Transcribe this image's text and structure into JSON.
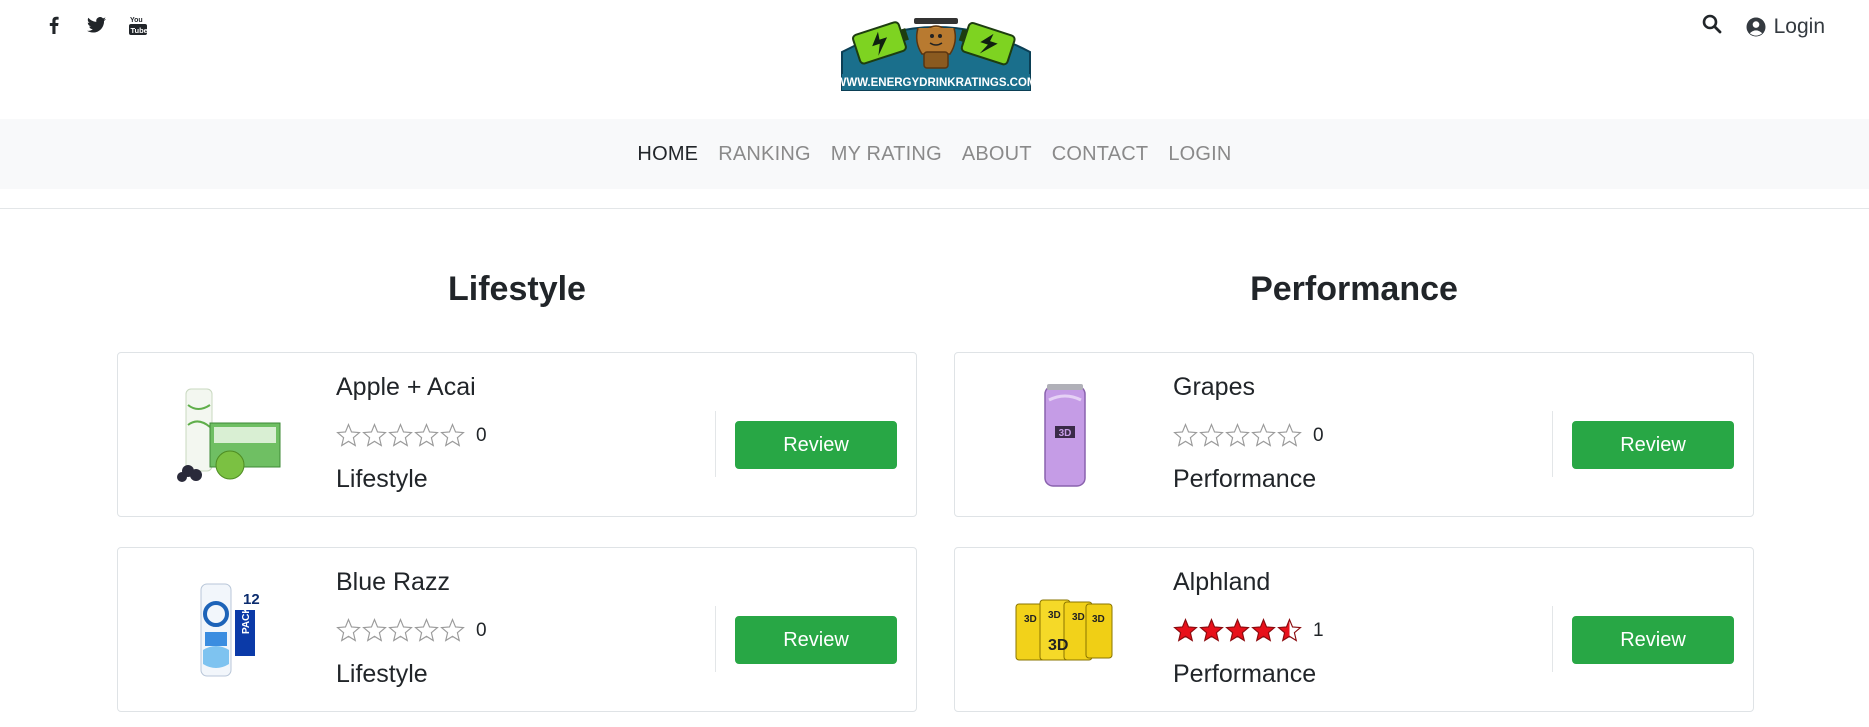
{
  "header": {
    "social": [
      "facebook-icon",
      "twitter-icon",
      "youtube-icon"
    ],
    "logo_text": "WWW.ENERGYDRINKRATINGS.COM",
    "login_label": "Login"
  },
  "nav": {
    "items": [
      {
        "label": "HOME",
        "active": true
      },
      {
        "label": "RANKING",
        "active": false
      },
      {
        "label": "MY RATING",
        "active": false
      },
      {
        "label": "ABOUT",
        "active": false
      },
      {
        "label": "CONTACT",
        "active": false
      },
      {
        "label": "LOGIN",
        "active": false
      }
    ]
  },
  "columns": [
    {
      "title": "Lifestyle",
      "cards": [
        {
          "name": "Apple + Acai",
          "rating": 0,
          "count": "0",
          "category": "Lifestyle",
          "button": "Review"
        },
        {
          "name": "Blue Razz",
          "rating": 0,
          "count": "0",
          "category": "Lifestyle",
          "button": "Review"
        }
      ]
    },
    {
      "title": "Performance",
      "cards": [
        {
          "name": "Grapes",
          "rating": 0,
          "count": "0",
          "category": "Performance",
          "button": "Review"
        },
        {
          "name": "Alphland",
          "rating": 4.5,
          "count": "1",
          "category": "Performance",
          "button": "Review"
        }
      ]
    }
  ],
  "colors": {
    "review_button": "#28a745",
    "nav_bg": "#f8f9fa",
    "star_filled": "#e8101a",
    "star_empty": "#ffffff"
  }
}
